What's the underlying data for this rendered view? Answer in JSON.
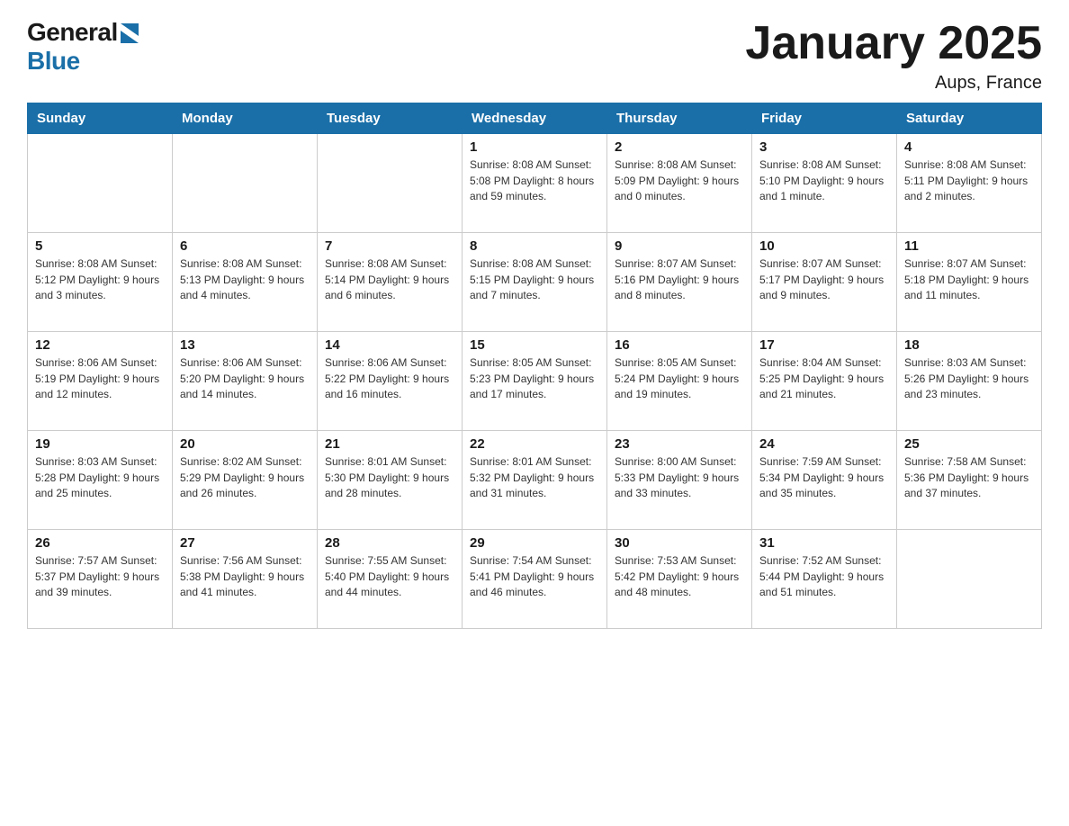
{
  "header": {
    "title": "January 2025",
    "subtitle": "Aups, France",
    "logo_general": "General",
    "logo_blue": "Blue"
  },
  "days_of_week": [
    "Sunday",
    "Monday",
    "Tuesday",
    "Wednesday",
    "Thursday",
    "Friday",
    "Saturday"
  ],
  "weeks": [
    [
      {
        "day": "",
        "info": ""
      },
      {
        "day": "",
        "info": ""
      },
      {
        "day": "",
        "info": ""
      },
      {
        "day": "1",
        "info": "Sunrise: 8:08 AM\nSunset: 5:08 PM\nDaylight: 8 hours\nand 59 minutes."
      },
      {
        "day": "2",
        "info": "Sunrise: 8:08 AM\nSunset: 5:09 PM\nDaylight: 9 hours\nand 0 minutes."
      },
      {
        "day": "3",
        "info": "Sunrise: 8:08 AM\nSunset: 5:10 PM\nDaylight: 9 hours\nand 1 minute."
      },
      {
        "day": "4",
        "info": "Sunrise: 8:08 AM\nSunset: 5:11 PM\nDaylight: 9 hours\nand 2 minutes."
      }
    ],
    [
      {
        "day": "5",
        "info": "Sunrise: 8:08 AM\nSunset: 5:12 PM\nDaylight: 9 hours\nand 3 minutes."
      },
      {
        "day": "6",
        "info": "Sunrise: 8:08 AM\nSunset: 5:13 PM\nDaylight: 9 hours\nand 4 minutes."
      },
      {
        "day": "7",
        "info": "Sunrise: 8:08 AM\nSunset: 5:14 PM\nDaylight: 9 hours\nand 6 minutes."
      },
      {
        "day": "8",
        "info": "Sunrise: 8:08 AM\nSunset: 5:15 PM\nDaylight: 9 hours\nand 7 minutes."
      },
      {
        "day": "9",
        "info": "Sunrise: 8:07 AM\nSunset: 5:16 PM\nDaylight: 9 hours\nand 8 minutes."
      },
      {
        "day": "10",
        "info": "Sunrise: 8:07 AM\nSunset: 5:17 PM\nDaylight: 9 hours\nand 9 minutes."
      },
      {
        "day": "11",
        "info": "Sunrise: 8:07 AM\nSunset: 5:18 PM\nDaylight: 9 hours\nand 11 minutes."
      }
    ],
    [
      {
        "day": "12",
        "info": "Sunrise: 8:06 AM\nSunset: 5:19 PM\nDaylight: 9 hours\nand 12 minutes."
      },
      {
        "day": "13",
        "info": "Sunrise: 8:06 AM\nSunset: 5:20 PM\nDaylight: 9 hours\nand 14 minutes."
      },
      {
        "day": "14",
        "info": "Sunrise: 8:06 AM\nSunset: 5:22 PM\nDaylight: 9 hours\nand 16 minutes."
      },
      {
        "day": "15",
        "info": "Sunrise: 8:05 AM\nSunset: 5:23 PM\nDaylight: 9 hours\nand 17 minutes."
      },
      {
        "day": "16",
        "info": "Sunrise: 8:05 AM\nSunset: 5:24 PM\nDaylight: 9 hours\nand 19 minutes."
      },
      {
        "day": "17",
        "info": "Sunrise: 8:04 AM\nSunset: 5:25 PM\nDaylight: 9 hours\nand 21 minutes."
      },
      {
        "day": "18",
        "info": "Sunrise: 8:03 AM\nSunset: 5:26 PM\nDaylight: 9 hours\nand 23 minutes."
      }
    ],
    [
      {
        "day": "19",
        "info": "Sunrise: 8:03 AM\nSunset: 5:28 PM\nDaylight: 9 hours\nand 25 minutes."
      },
      {
        "day": "20",
        "info": "Sunrise: 8:02 AM\nSunset: 5:29 PM\nDaylight: 9 hours\nand 26 minutes."
      },
      {
        "day": "21",
        "info": "Sunrise: 8:01 AM\nSunset: 5:30 PM\nDaylight: 9 hours\nand 28 minutes."
      },
      {
        "day": "22",
        "info": "Sunrise: 8:01 AM\nSunset: 5:32 PM\nDaylight: 9 hours\nand 31 minutes."
      },
      {
        "day": "23",
        "info": "Sunrise: 8:00 AM\nSunset: 5:33 PM\nDaylight: 9 hours\nand 33 minutes."
      },
      {
        "day": "24",
        "info": "Sunrise: 7:59 AM\nSunset: 5:34 PM\nDaylight: 9 hours\nand 35 minutes."
      },
      {
        "day": "25",
        "info": "Sunrise: 7:58 AM\nSunset: 5:36 PM\nDaylight: 9 hours\nand 37 minutes."
      }
    ],
    [
      {
        "day": "26",
        "info": "Sunrise: 7:57 AM\nSunset: 5:37 PM\nDaylight: 9 hours\nand 39 minutes."
      },
      {
        "day": "27",
        "info": "Sunrise: 7:56 AM\nSunset: 5:38 PM\nDaylight: 9 hours\nand 41 minutes."
      },
      {
        "day": "28",
        "info": "Sunrise: 7:55 AM\nSunset: 5:40 PM\nDaylight: 9 hours\nand 44 minutes."
      },
      {
        "day": "29",
        "info": "Sunrise: 7:54 AM\nSunset: 5:41 PM\nDaylight: 9 hours\nand 46 minutes."
      },
      {
        "day": "30",
        "info": "Sunrise: 7:53 AM\nSunset: 5:42 PM\nDaylight: 9 hours\nand 48 minutes."
      },
      {
        "day": "31",
        "info": "Sunrise: 7:52 AM\nSunset: 5:44 PM\nDaylight: 9 hours\nand 51 minutes."
      },
      {
        "day": "",
        "info": ""
      }
    ]
  ]
}
